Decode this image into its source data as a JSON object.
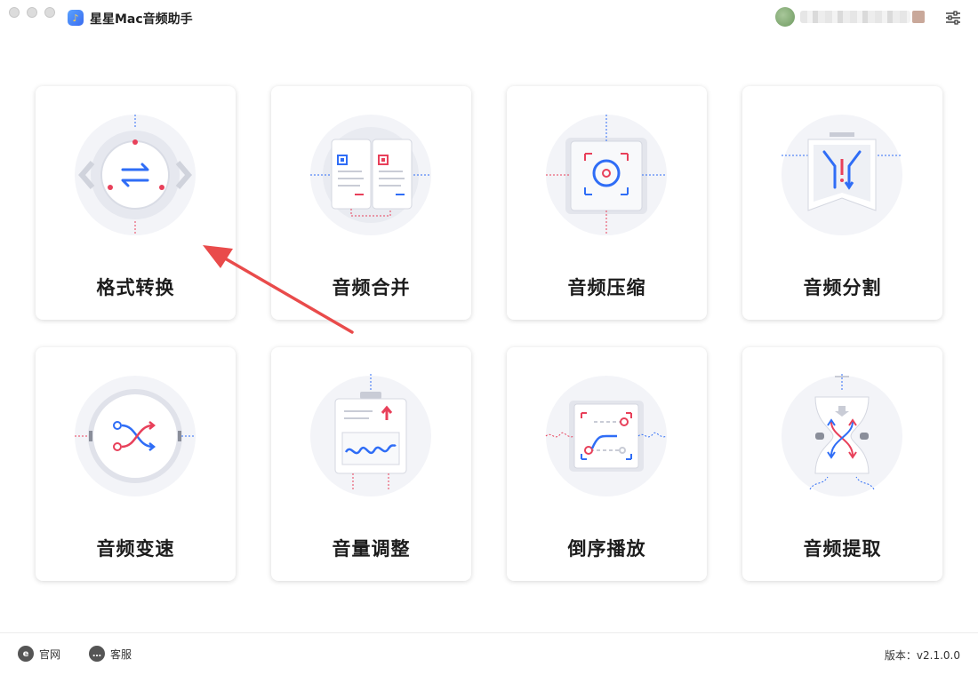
{
  "app": {
    "title": "星星Mac音频助手"
  },
  "cards": [
    {
      "label": "格式转换",
      "icon": "format-convert-icon"
    },
    {
      "label": "音频合并",
      "icon": "audio-merge-icon"
    },
    {
      "label": "音频压缩",
      "icon": "audio-compress-icon"
    },
    {
      "label": "音频分割",
      "icon": "audio-split-icon"
    },
    {
      "label": "音频变速",
      "icon": "audio-speed-icon"
    },
    {
      "label": "音量调整",
      "icon": "volume-adjust-icon"
    },
    {
      "label": "倒序播放",
      "icon": "reverse-play-icon"
    },
    {
      "label": "音频提取",
      "icon": "audio-extract-icon"
    }
  ],
  "footer": {
    "website_label": "官网",
    "support_label": "客服",
    "version_text": "版本：v2.1.0.0"
  },
  "colors": {
    "accent_blue": "#2f6df6",
    "accent_red": "#e8405a",
    "annotation_arrow": "#e94b4b"
  }
}
